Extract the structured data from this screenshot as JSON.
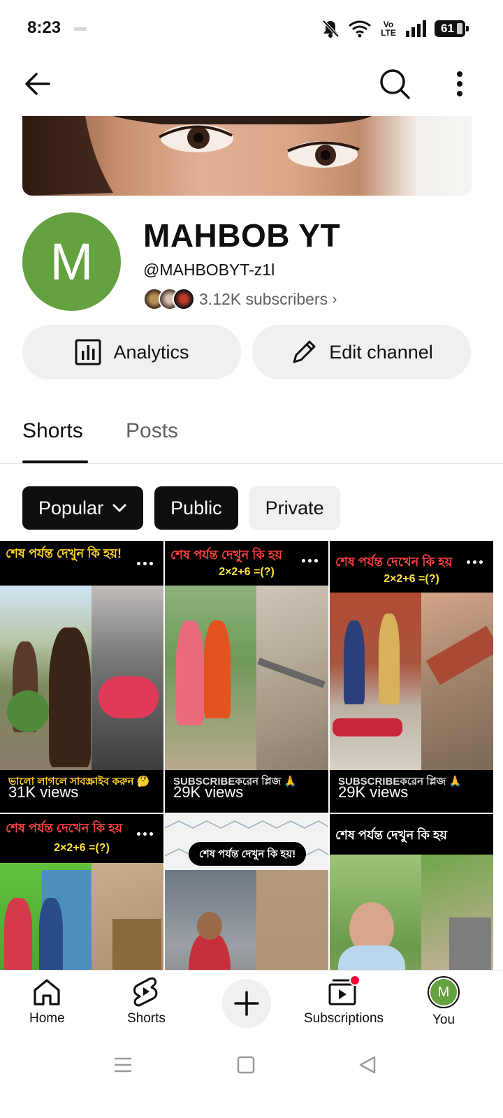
{
  "status_bar": {
    "time": "8:23",
    "network": "Vo LTE",
    "battery": "61"
  },
  "top_bar": {
    "back_icon": "arrow-left-icon",
    "search_icon": "search-icon",
    "more_icon": "more-vertical-icon"
  },
  "channel": {
    "avatar_letter": "M",
    "name": "MAHBOB YT",
    "handle": "@MAHBOBYT-z1l",
    "subscribers": "3.12K subscribers",
    "avatar_color": "#64a13f"
  },
  "actions": {
    "analytics_label": "Analytics",
    "edit_label": "Edit channel"
  },
  "tabs": {
    "shorts": "Shorts",
    "posts": "Posts",
    "selected": "Shorts"
  },
  "chips": {
    "sort_label": "Popular",
    "public_label": "Public",
    "private_label": "Private"
  },
  "shorts": [
    {
      "views": "31K views",
      "header": "শেষ পর্যন্ত দেখুন কি হয়!",
      "subheader": "",
      "footer": "ভালো লাগলে সাবস্ক্রাইব করুন 🤔"
    },
    {
      "views": "29K views",
      "header": "শেষ পর্যন্ত দেখুন কি হয়",
      "subheader": "2×2+6 =(?)",
      "footer": "SUBSCRIBEকরেন প্লিজ 🙏"
    },
    {
      "views": "29K views",
      "header": "শেষ পর্যন্ত দেখেন কি হয়",
      "subheader": "2×2+6 =(?)",
      "footer": "SUBSCRIBEকরেন প্লিজ 🙏"
    },
    {
      "views": "",
      "header": "শেষ পর্যন্ত দেখেন কি হয়",
      "subheader": "2×2+6 =(?)",
      "footer": ""
    },
    {
      "views": "",
      "header": "শেষ পর্যন্ত দেখুন কি হয়!",
      "subheader": "",
      "footer": ""
    },
    {
      "views": "",
      "header": "শেষ পর্যন্ত দেখুন কি হয়",
      "subheader": "",
      "footer": ""
    }
  ],
  "bottom_nav": {
    "home": "Home",
    "shorts": "Shorts",
    "create_icon": "plus-icon",
    "subscriptions": "Subscriptions",
    "you": "You",
    "you_avatar_letter": "M"
  },
  "colors": {
    "accent_dark": "#0f0f0f",
    "chip_light": "#f0f0f0",
    "secondary_text": "#606060",
    "notification_dot": "#ff0033"
  }
}
